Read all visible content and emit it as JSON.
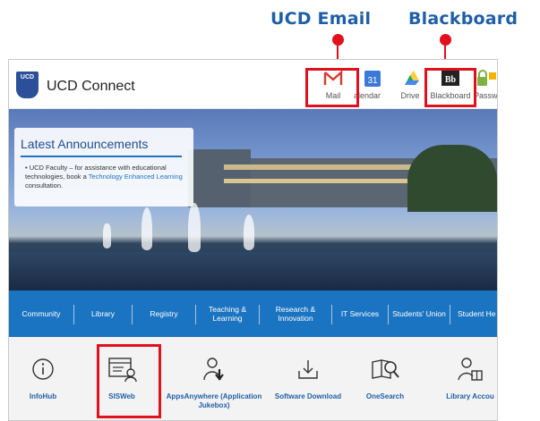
{
  "callouts": {
    "email": "UCD Email",
    "blackboard": "Blackboard"
  },
  "header": {
    "logo_text": "UCD",
    "title": "UCD Connect"
  },
  "apps": [
    {
      "label": "Mail",
      "icon": "gmail-icon"
    },
    {
      "label": "Calendar",
      "icon": "calendar-icon",
      "badge": "31"
    },
    {
      "label": "Drive",
      "icon": "drive-icon"
    },
    {
      "label": "Blackboard",
      "icon": "blackboard-icon",
      "badge": "Bb"
    },
    {
      "label": "Passw",
      "icon": "password-icon"
    }
  ],
  "announcement": {
    "title": "Latest Announcements",
    "text": "UCD Faculty – for assistance with educational technologies, book a",
    "link": "Technology Enhanced Learning",
    "suffix": "consultation."
  },
  "nav": [
    "Community",
    "Library",
    "Registry",
    "Teaching & Learning",
    "Research & Innovation",
    "IT Services",
    "Students' Union",
    "Student He"
  ],
  "quick_links": [
    {
      "label": "InfoHub",
      "icon": "info-icon"
    },
    {
      "label": "SISWeb",
      "icon": "sisweb-icon"
    },
    {
      "label": "AppsAnywhere (Application Jukebox)",
      "icon": "appsanywhere-icon"
    },
    {
      "label": "Software Download",
      "icon": "software-download-icon"
    },
    {
      "label": "OneSearch",
      "icon": "onesearch-icon"
    },
    {
      "label": "Library Accou",
      "icon": "library-account-icon"
    }
  ],
  "colors": {
    "highlight": "#e0101d",
    "nav_blue": "#1b74c1",
    "brand_blue": "#1f5fa6"
  }
}
